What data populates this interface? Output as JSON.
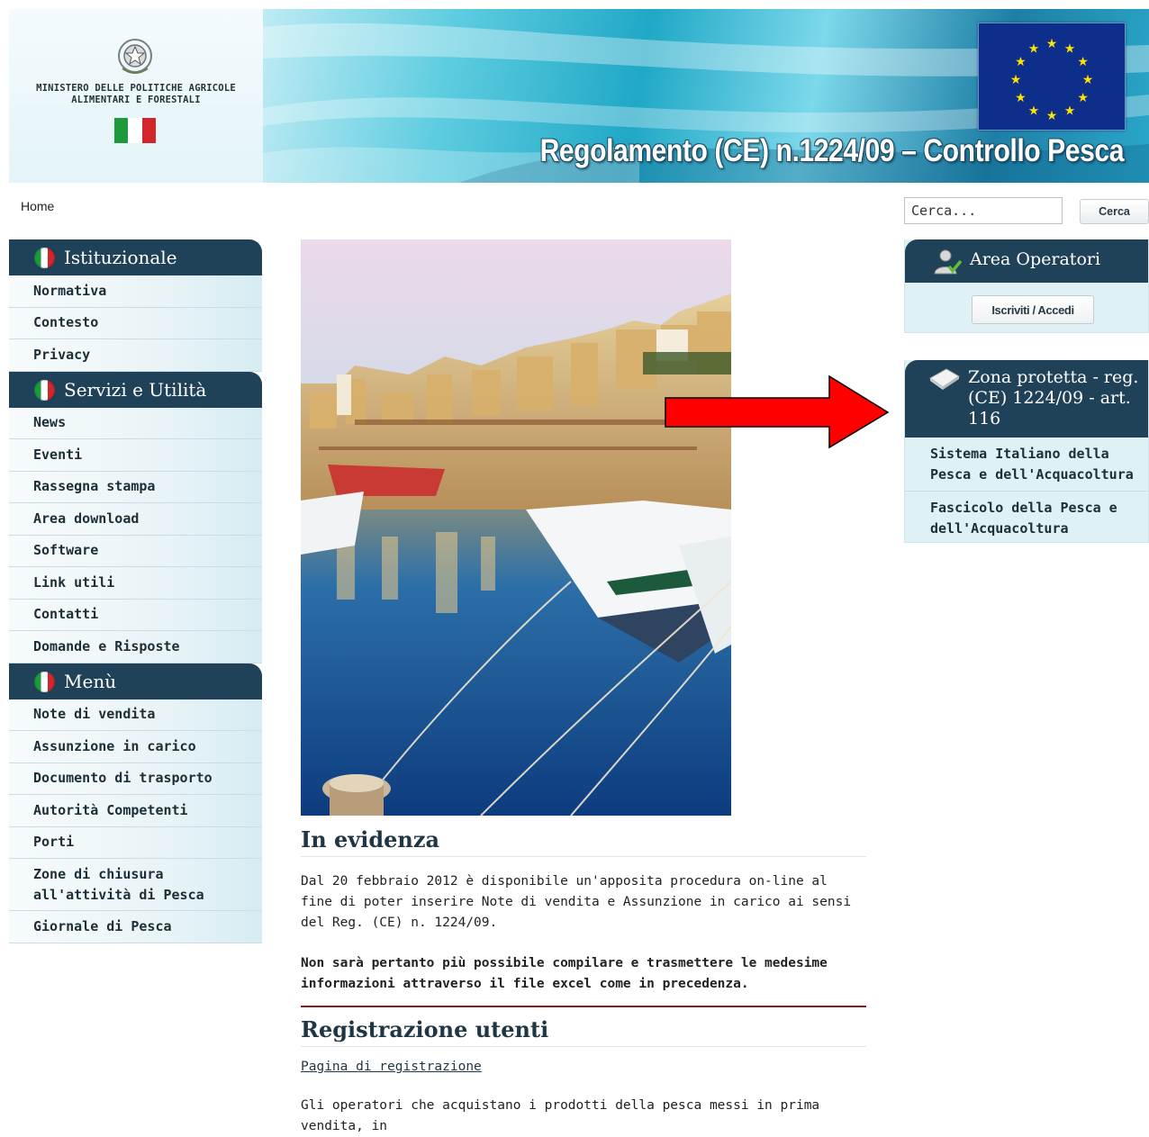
{
  "header": {
    "ministry_name": "MINISTERO DELLE POLITICHE AGRICOLE ALIMENTARI E FORESTALI",
    "title": "Regolamento (CE) n.1224/09 – Controllo Pesca",
    "flag_colors": [
      "#1d9a3c",
      "#ffffff",
      "#d3262b"
    ],
    "eu_flag_color": "#0d2e8a",
    "star_color": "#ffe000"
  },
  "breadcrumb": {
    "home": "Home"
  },
  "search": {
    "placeholder": "Cerca...",
    "button_label": "Cerca"
  },
  "sidebar": {
    "sections": [
      {
        "title": "Istituzionale",
        "items": [
          "Normativa",
          "Contesto",
          "Privacy"
        ]
      },
      {
        "title": "Servizi e Utilità",
        "items": [
          "News",
          "Eventi",
          "Rassegna stampa",
          "Area download",
          "Software",
          "Link utili",
          "Contatti",
          "Domande e Risposte"
        ]
      },
      {
        "title": "Menù",
        "items": [
          "Note di vendita",
          "Assunzione in carico",
          "Documento di trasporto",
          "Autorità Competenti",
          "Porti",
          "Zone di chiusura all'attività di Pesca",
          "Giornale di Pesca"
        ]
      }
    ]
  },
  "main": {
    "evidenza_title": "In evidenza",
    "evidenza_text": "Dal 20 febbraio 2012 è disponibile un'apposita procedura on-line al fine di poter inserire Note di vendita e Assunzione in carico ai sensi del Reg. (CE) n. 1224/09.",
    "evidenza_bold": "Non sarà pertanto più possibile compilare e trasmettere le medesime informazioni attraverso il file excel come in precedenza.",
    "registrazione_title": "Registrazione utenti",
    "registrazione_link": "Pagina di registrazione",
    "registrazione_text": "Gli operatori che acquistano i prodotti della pesca messi in prima vendita, in"
  },
  "right": {
    "area_operatori": {
      "title": "Area Operatori",
      "button_label": "Iscriviti / Accedi"
    },
    "zona_protetta": {
      "title": "Zona protetta - reg. (CE) 1224/09 - art. 116",
      "links": [
        "Sistema Italiano della Pesca e dell'Acquacoltura",
        "Fascicolo della Pesca e dell'Acquacoltura"
      ]
    }
  },
  "colors": {
    "nav_dark": "#1f4259",
    "arrow": "#ff0000",
    "divider": "#8b1d1d"
  },
  "icons": {
    "user": "user-check-icon",
    "book": "book-icon",
    "flag": "italian-flag-icon",
    "emblem": "republic-emblem-icon"
  }
}
